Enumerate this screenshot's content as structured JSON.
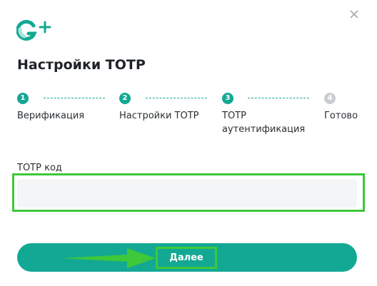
{
  "title": "Настройки TOTP",
  "steps": [
    {
      "num": "1",
      "label": "Верификация"
    },
    {
      "num": "2",
      "label": "Настройки TOTP"
    },
    {
      "num": "3",
      "label": "TOTP аутентификация"
    },
    {
      "num": "4",
      "label": "Готово"
    }
  ],
  "field": {
    "label": "TOTP код",
    "value": "",
    "placeholder": ""
  },
  "button": {
    "next_label": "Далее"
  },
  "icons": {
    "logo": "g-plus-logo",
    "close": "close-icon",
    "annotation": "green-arrow-icon"
  },
  "colors": {
    "accent": "#13a894",
    "pending": "#c9ced4",
    "highlight": "#3ec83a"
  }
}
